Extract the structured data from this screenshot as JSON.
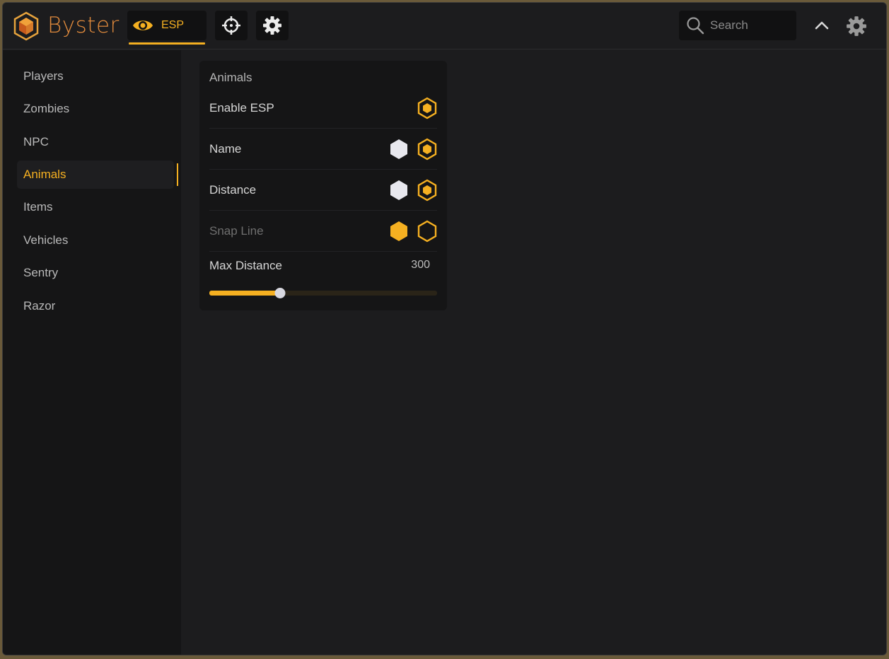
{
  "app": {
    "brand": "Byster"
  },
  "header": {
    "tabs": [
      {
        "label": "ESP",
        "icon": "eye-icon",
        "active": true
      },
      {
        "label": "",
        "icon": "crosshair-icon",
        "active": false
      },
      {
        "label": "",
        "icon": "gear-icon",
        "active": false
      }
    ],
    "search": {
      "placeholder": "Search",
      "value": ""
    },
    "collapse_icon": "chevron-up-icon",
    "settings_icon": "gear-icon"
  },
  "sidebar": {
    "items": [
      {
        "label": "Players",
        "active": false
      },
      {
        "label": "Zombies",
        "active": false
      },
      {
        "label": "NPC",
        "active": false
      },
      {
        "label": "Animals",
        "active": true
      },
      {
        "label": "Items",
        "active": false
      },
      {
        "label": "Vehicles",
        "active": false
      },
      {
        "label": "Sentry",
        "active": false
      },
      {
        "label": "Razor",
        "active": false
      }
    ]
  },
  "panel": {
    "title": "Animals",
    "rows": [
      {
        "label": "Enable ESP",
        "controls": [
          "toggle-on"
        ],
        "disabled": false
      },
      {
        "label": "Name",
        "controls": [
          "color-white",
          "toggle-on"
        ],
        "disabled": false
      },
      {
        "label": "Distance",
        "controls": [
          "color-white",
          "toggle-on"
        ],
        "disabled": false
      },
      {
        "label": "Snap Line",
        "controls": [
          "color-yellow",
          "toggle-off"
        ],
        "disabled": true
      }
    ],
    "slider": {
      "label": "Max Distance",
      "value": "300",
      "fraction": 0.31
    }
  },
  "colors": {
    "accent": "#f5b021",
    "brand": "#e08a3c",
    "background": "#1c1c1e",
    "sidebar": "#151516"
  }
}
